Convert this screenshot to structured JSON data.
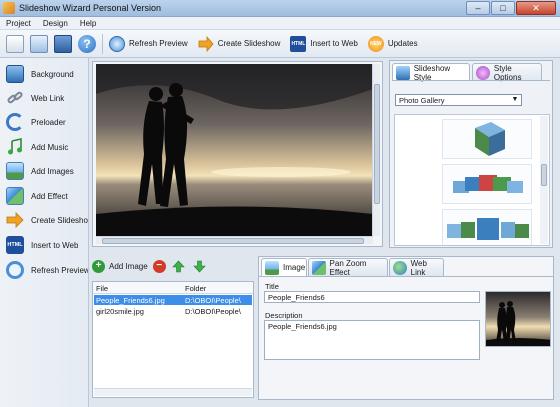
{
  "window": {
    "title": "Slideshow Wizard Personal Version",
    "controls": [
      "–",
      "□",
      "✕"
    ]
  },
  "menu": [
    "Project",
    "Design",
    "Help"
  ],
  "toolbar": {
    "buttons": [
      {
        "label": "Refresh Preview",
        "icon": "refresh-preview-icon"
      },
      {
        "label": "Create Slideshow",
        "icon": "create-slideshow-arrow-icon"
      },
      {
        "label": "Insert to Web",
        "icon": "html-icon"
      },
      {
        "label": "Updates",
        "icon": "new-badge-icon"
      }
    ]
  },
  "sidebar": {
    "items": [
      {
        "label": "Background",
        "icon": "monitor-icon"
      },
      {
        "label": "Web Link",
        "icon": "chain-link-icon"
      },
      {
        "label": "Preloader",
        "icon": "refresh-icon"
      },
      {
        "label": "Add Music",
        "icon": "music-note-icon"
      },
      {
        "label": "Add Images",
        "icon": "images-icon"
      },
      {
        "label": "Add Effect",
        "icon": "effect-icon"
      },
      {
        "label": "Create Slideshow",
        "icon": "arrow-right-icon"
      },
      {
        "label": "Insert to Web",
        "icon": "html-icon"
      },
      {
        "label": "Refresh Preview",
        "icon": "magnifier-icon"
      }
    ]
  },
  "style_panel": {
    "tabs": [
      {
        "label": "Slideshow Style",
        "active": true
      },
      {
        "label": "Style Options",
        "active": false
      }
    ],
    "dropdown_value": "Photo Gallery"
  },
  "files": {
    "add_label": "Add Image",
    "columns": [
      "File",
      "Folder"
    ],
    "rows": [
      {
        "file": "People_Friends6.jpg",
        "folder": "D:\\OBOI\\People\\",
        "selected": true
      },
      {
        "file": "girl20smile.jpg",
        "folder": "D:\\OBOI\\People\\",
        "selected": false
      }
    ]
  },
  "properties": {
    "tabs": [
      {
        "label": "Image",
        "active": true
      },
      {
        "label": "Pan Zoom Effect",
        "active": false
      },
      {
        "label": "Web Link",
        "active": false
      }
    ],
    "title_label": "Title",
    "title_value": "People_Friends6",
    "description_label": "Description",
    "description_value": "People_Friends6.jpg"
  },
  "colors": {
    "selection": "#3d8ee8",
    "accent_blue": "#3b79c6"
  }
}
